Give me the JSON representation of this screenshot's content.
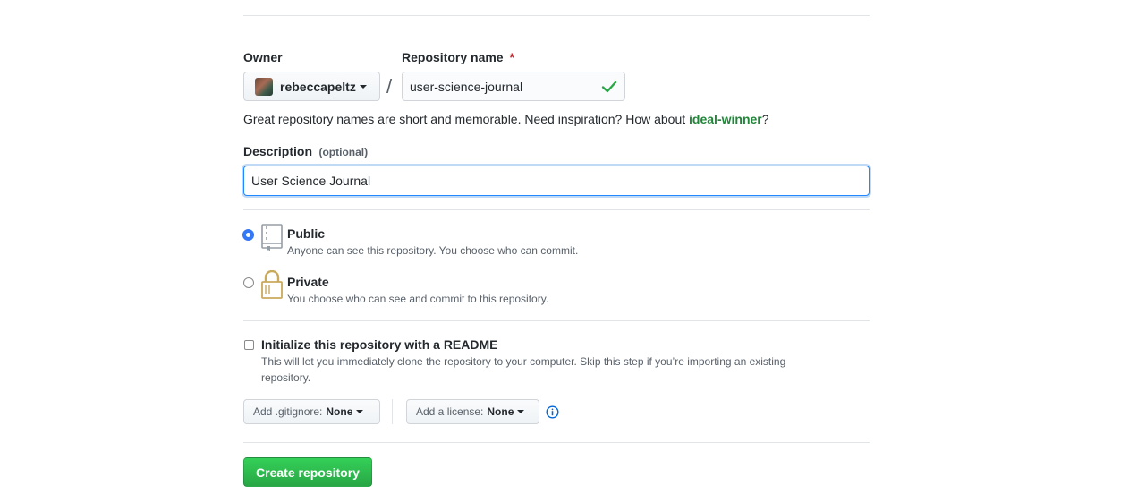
{
  "owner": {
    "label": "Owner",
    "value": "rebeccapeltz"
  },
  "repo_name": {
    "label": "Repository name",
    "required_mark": "*",
    "value": "user-science-journal"
  },
  "separator": "/",
  "name_hint": {
    "text": "Great repository names are short and memorable. Need inspiration? How about ",
    "suggestion": "ideal-winner",
    "end": "?"
  },
  "description": {
    "label": "Description",
    "optional": "(optional)",
    "value": "User Science Journal"
  },
  "visibility": {
    "public": {
      "title": "Public",
      "note": "Anyone can see this repository. You choose who can commit.",
      "selected": true
    },
    "private": {
      "title": "Private",
      "note": "You choose who can see and commit to this repository.",
      "selected": false
    }
  },
  "readme": {
    "title": "Initialize this repository with a README",
    "note_line1": "This will let you immediately clone the repository to your computer. Skip this step if you’re importing an existing",
    "note_line2": "repository.",
    "checked": false
  },
  "gitignore": {
    "label": "Add .gitignore:",
    "value": "None"
  },
  "license": {
    "label": "Add a license:",
    "value": "None"
  },
  "create_button": "Create repository",
  "colors": {
    "accent_green": "#28a745",
    "link_green": "#22863a",
    "focus_blue": "#2188ff",
    "required_red": "#cb2431"
  }
}
